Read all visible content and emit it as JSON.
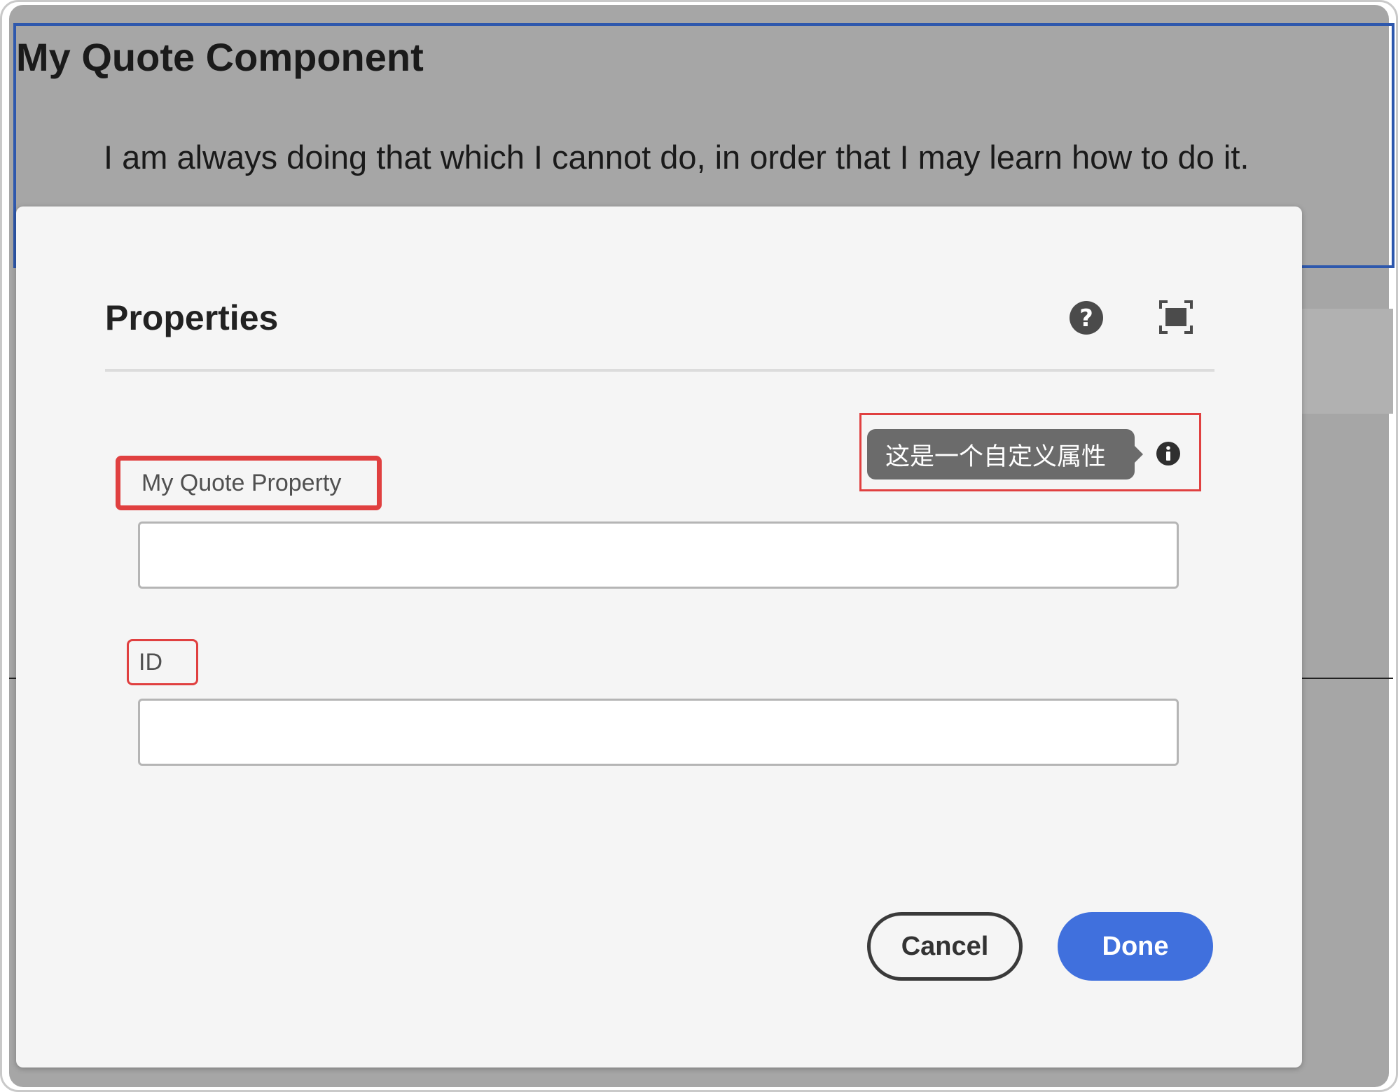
{
  "component": {
    "title": "My Quote Component",
    "quote": "I am always doing that which I cannot do, in order that I may learn how to do it."
  },
  "dialog": {
    "title": "Properties",
    "help_icon": "help-circle-icon",
    "fullscreen_icon": "fullscreen-icon",
    "tooltip": {
      "text": "这是一个自定义属性",
      "icon": "info-circle-icon"
    },
    "fields": [
      {
        "label": "My Quote Property",
        "value": ""
      },
      {
        "label": "ID",
        "value": ""
      }
    ],
    "buttons": {
      "cancel": "Cancel",
      "done": "Done"
    }
  },
  "colors": {
    "accent": "#4070dd",
    "highlight": "#e04040",
    "component_border": "#2e58ad",
    "overlay": "#a6a6a6"
  }
}
